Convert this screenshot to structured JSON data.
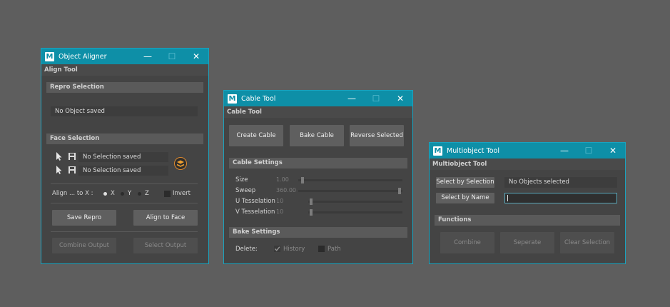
{
  "aligner": {
    "title": "Object Aligner",
    "menu": "Align Tool",
    "repro_section": "Repro Selection",
    "repro_field": "No Object saved",
    "face_section": "Face Selection",
    "face_row1": "No Selection saved",
    "face_row2": "No Selection saved",
    "align_label": "Align ... to X :",
    "axis_x": "X",
    "axis_y": "Y",
    "axis_z": "Z",
    "selected_axis": "X",
    "invert": "Invert",
    "save_repro": "Save Repro",
    "align_to_face": "Align to Face",
    "combine_output": "Combine Output",
    "select_output": "Select Output"
  },
  "cable": {
    "title": "Cable Tool",
    "menu": "Cable Tool",
    "create_cable": "Create Cable",
    "bake_cable": "Bake Cable",
    "reverse_selected": "Reverse Selected",
    "settings_section": "Cable Settings",
    "size_label": "Size",
    "size_value": "1.00",
    "sweep_label": "Sweep",
    "sweep_value": "360.00",
    "u_label": "U Tesselation",
    "u_value": "10",
    "v_label": "V Tesselation",
    "v_value": "10",
    "bake_section": "Bake Settings",
    "delete_label": "Delete:",
    "history": "History",
    "history_checked": true,
    "path": "Path",
    "path_checked": false
  },
  "multi": {
    "title": "Multiobject Tool",
    "menu": "Multiobject Tool",
    "select_by_selection": "Select by Selection",
    "objects_status": "No Objects selected",
    "select_by_name": "Select by Name",
    "name_input_value": "",
    "functions_section": "Functions",
    "combine": "Combine",
    "seperate": "Seperate",
    "clear_selection": "Clear Selection"
  },
  "window_controls": {
    "minimize": "—",
    "maximize": "☐",
    "close": "✕"
  },
  "logo_glyph": "M",
  "colors": {
    "titlebar": "#0e8fa7",
    "accent_border": "#1aa3bf",
    "background": "#5e5e5e",
    "panel": "#444444"
  }
}
